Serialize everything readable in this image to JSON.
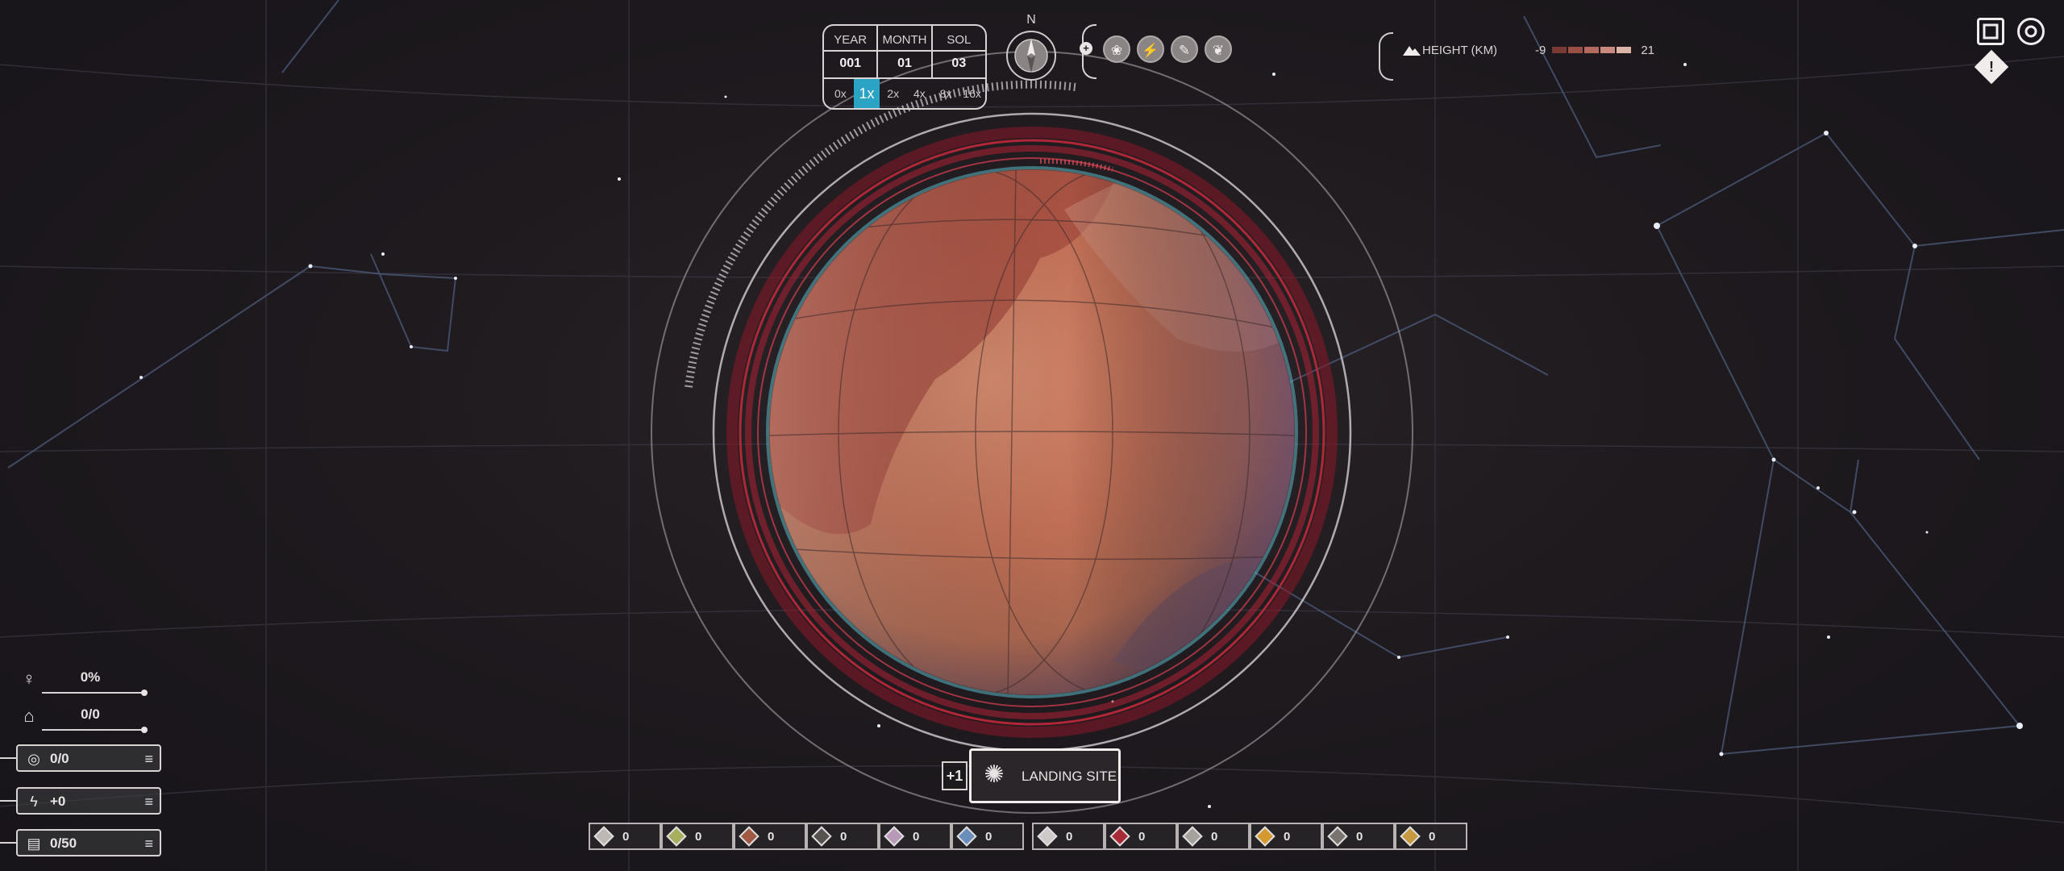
{
  "date": {
    "labels": [
      "YEAR",
      "MONTH",
      "SOL"
    ],
    "values": [
      "001",
      "01",
      "03"
    ],
    "speeds": [
      "0x",
      "1x",
      "2x",
      "4x",
      "8x",
      "16x"
    ],
    "active_speed_index": 1
  },
  "compass": {
    "north": "N"
  },
  "map_modes": {
    "dot_symbol": "+",
    "buttons": [
      {
        "name": "map-mode-vegetation-icon",
        "glyph": "❀"
      },
      {
        "name": "map-mode-energy-icon",
        "glyph": "⚡"
      },
      {
        "name": "map-mode-build-icon",
        "glyph": "✎"
      },
      {
        "name": "map-mode-flora-icon",
        "glyph": "❦"
      }
    ]
  },
  "height_legend": {
    "label": "HEIGHT (KM)",
    "min": "-9",
    "max": "21",
    "colors": [
      "#7a3a34",
      "#9a4e44",
      "#b46a5e",
      "#c98a7e",
      "#dcb4a8"
    ]
  },
  "alert_symbol": "!",
  "stats": {
    "oxygen": {
      "icon": "♀",
      "value": "0%"
    },
    "population": {
      "icon": "⌂",
      "value": "0/0"
    },
    "housing": {
      "icon": "◎",
      "value": "0/0",
      "menu": "≡"
    },
    "energy": {
      "icon": "ϟ",
      "value": "+0",
      "menu": "≡"
    },
    "storage": {
      "icon": "▤",
      "value": "0/50",
      "menu": "≡"
    }
  },
  "landing": {
    "plus": "+1",
    "label": "LANDING SITE"
  },
  "resources": [
    {
      "name": "resource-1",
      "color": "#bdb8b4",
      "value": "0"
    },
    {
      "name": "resource-2",
      "color": "#a8b060",
      "value": "0"
    },
    {
      "name": "resource-3",
      "color": "#a05a44",
      "value": "0"
    },
    {
      "name": "resource-4",
      "color": "#55524f",
      "value": "0"
    },
    {
      "name": "resource-5",
      "color": "#b89ab8",
      "value": "0"
    },
    {
      "name": "resource-6",
      "color": "#6a8ebc",
      "value": "0"
    },
    {
      "name": "resource-7",
      "color": "#cfcaca",
      "value": "0"
    },
    {
      "name": "resource-8",
      "color": "#a82a36",
      "value": "0"
    },
    {
      "name": "resource-9",
      "color": "#a5a19c",
      "value": "0"
    },
    {
      "name": "resource-10",
      "color": "#d49a30",
      "value": "0"
    },
    {
      "name": "resource-11",
      "color": "#7a7470",
      "value": "0"
    },
    {
      "name": "resource-12",
      "color": "#c89a40",
      "value": "0"
    }
  ]
}
